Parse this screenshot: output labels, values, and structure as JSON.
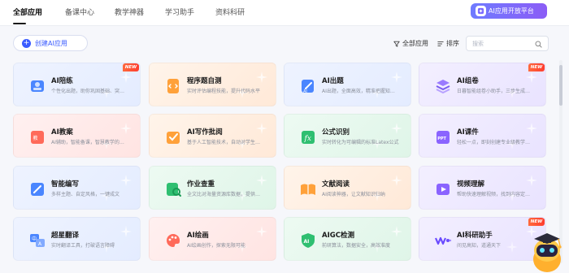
{
  "nav": {
    "tabs": [
      {
        "label": "全部应用",
        "active": true
      },
      {
        "label": "备课中心",
        "active": false
      },
      {
        "label": "教学神器",
        "active": false
      },
      {
        "label": "学习助手",
        "active": false
      },
      {
        "label": "资料科研",
        "active": false
      }
    ],
    "open_platform_label": "AI应用开放平台",
    "open_platform_icon": "sparkle-chip-icon"
  },
  "toolbar": {
    "create_label": "创建AI应用",
    "filter_label": "全部应用",
    "filter_icon": "filter-icon",
    "sort_label": "排序",
    "sort_icon": "sort-icon",
    "search_placeholder": "搜索",
    "search_icon": "search-icon"
  },
  "badge_new": "NEW",
  "colors": {
    "accent": "#3a5bff",
    "platform_gradient": [
      "#6f7bff",
      "#8b5cf6"
    ],
    "new_badge": "#ff4a30"
  },
  "cards": [
    {
      "title": "AI陪练",
      "desc": "个性化出题，助你巩固基础、突…",
      "bg": "blue",
      "icon": "reading-person-icon",
      "new": true
    },
    {
      "title": "程序题自测",
      "desc": "实时评估编程技能，提升代码水平",
      "bg": "orange",
      "icon": "code-document-icon",
      "new": false
    },
    {
      "title": "AI出题",
      "desc": "AI出题，全面高效，精准把握知…",
      "bg": "blue",
      "icon": "pen-document-icon",
      "new": false
    },
    {
      "title": "AI组卷",
      "desc": "日暮智能组卷小助手，三步生成…",
      "bg": "purple",
      "icon": "layers-icon",
      "new": true
    },
    {
      "title": "AI教案",
      "desc": "AI辅助，智能备课，智慧教学的…",
      "bg": "pink",
      "icon": "lesson-plan-icon",
      "new": false
    },
    {
      "title": "AI写作批阅",
      "desc": "基于人工智能技术，自动对学生…",
      "bg": "orange",
      "icon": "writing-review-icon",
      "new": false
    },
    {
      "title": "公式识别",
      "desc": "实时转化为可编辑的标准Latex公式",
      "bg": "green",
      "icon": "formula-icon",
      "new": false
    },
    {
      "title": "AI课件",
      "desc": "轻松一点，即刻创建专业级教学…",
      "bg": "purple",
      "icon": "ppt-icon",
      "new": false
    },
    {
      "title": "智能编写",
      "desc": "多样主题、自定风格，一键成文",
      "bg": "blue",
      "icon": "edit-icon",
      "new": false
    },
    {
      "title": "作业查重",
      "desc": "全文比对海量资源库数据，提供…",
      "bg": "green",
      "icon": "plagiarism-check-icon",
      "new": false
    },
    {
      "title": "文献阅读",
      "desc": "AI阅读神器，让文献知识归纳",
      "bg": "orange",
      "icon": "open-book-icon",
      "new": false
    },
    {
      "title": "视频理解",
      "desc": "帮助快速理解视频，找到内容定…",
      "bg": "purple",
      "icon": "video-play-icon",
      "new": false
    },
    {
      "title": "超星翻译",
      "desc": "实时翻译工具，打破语言障碍",
      "bg": "blue",
      "icon": "translate-icon",
      "new": false
    },
    {
      "title": "AI绘画",
      "desc": "AI绘画创作，探索无限可能",
      "bg": "pink",
      "icon": "palette-icon",
      "new": false
    },
    {
      "title": "AIGC检测",
      "desc": "前研算法，数据安全，高效准度",
      "bg": "green",
      "icon": "aigc-shield-icon",
      "new": false
    },
    {
      "title": "AI科研助手",
      "desc": "间见高知，道通天下",
      "bg": "purple",
      "icon": "research-wave-icon",
      "new": true
    }
  ],
  "mascot_icon": "robot-mascot-icon"
}
